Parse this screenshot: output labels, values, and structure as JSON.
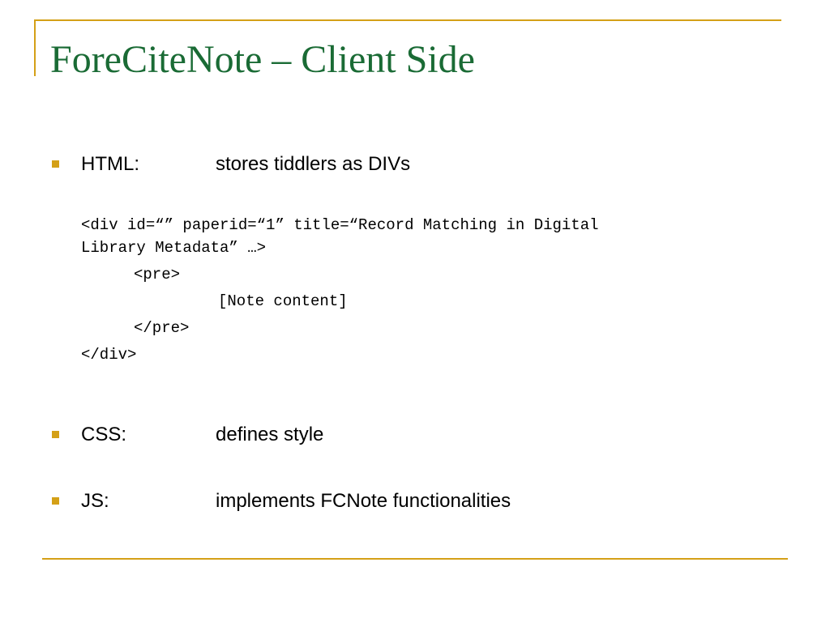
{
  "slide": {
    "title": "ForeCiteNote – Client Side",
    "bullets": [
      {
        "label": "HTML:",
        "description": "stores tiddlers as DIVs"
      },
      {
        "label": "CSS:",
        "description": "defines style"
      },
      {
        "label": "JS:",
        "description": "implements FCNote functionalities"
      }
    ],
    "code_lines": [
      "<div id=“” paperid=“1” title=“Record Matching in Digital",
      "Library Metadata” …>",
      "<pre>",
      "[Note content]",
      "</pre>",
      "</div>"
    ]
  },
  "colors": {
    "title": "#1a6b35",
    "accent": "#d4a017",
    "text": "#000000"
  }
}
